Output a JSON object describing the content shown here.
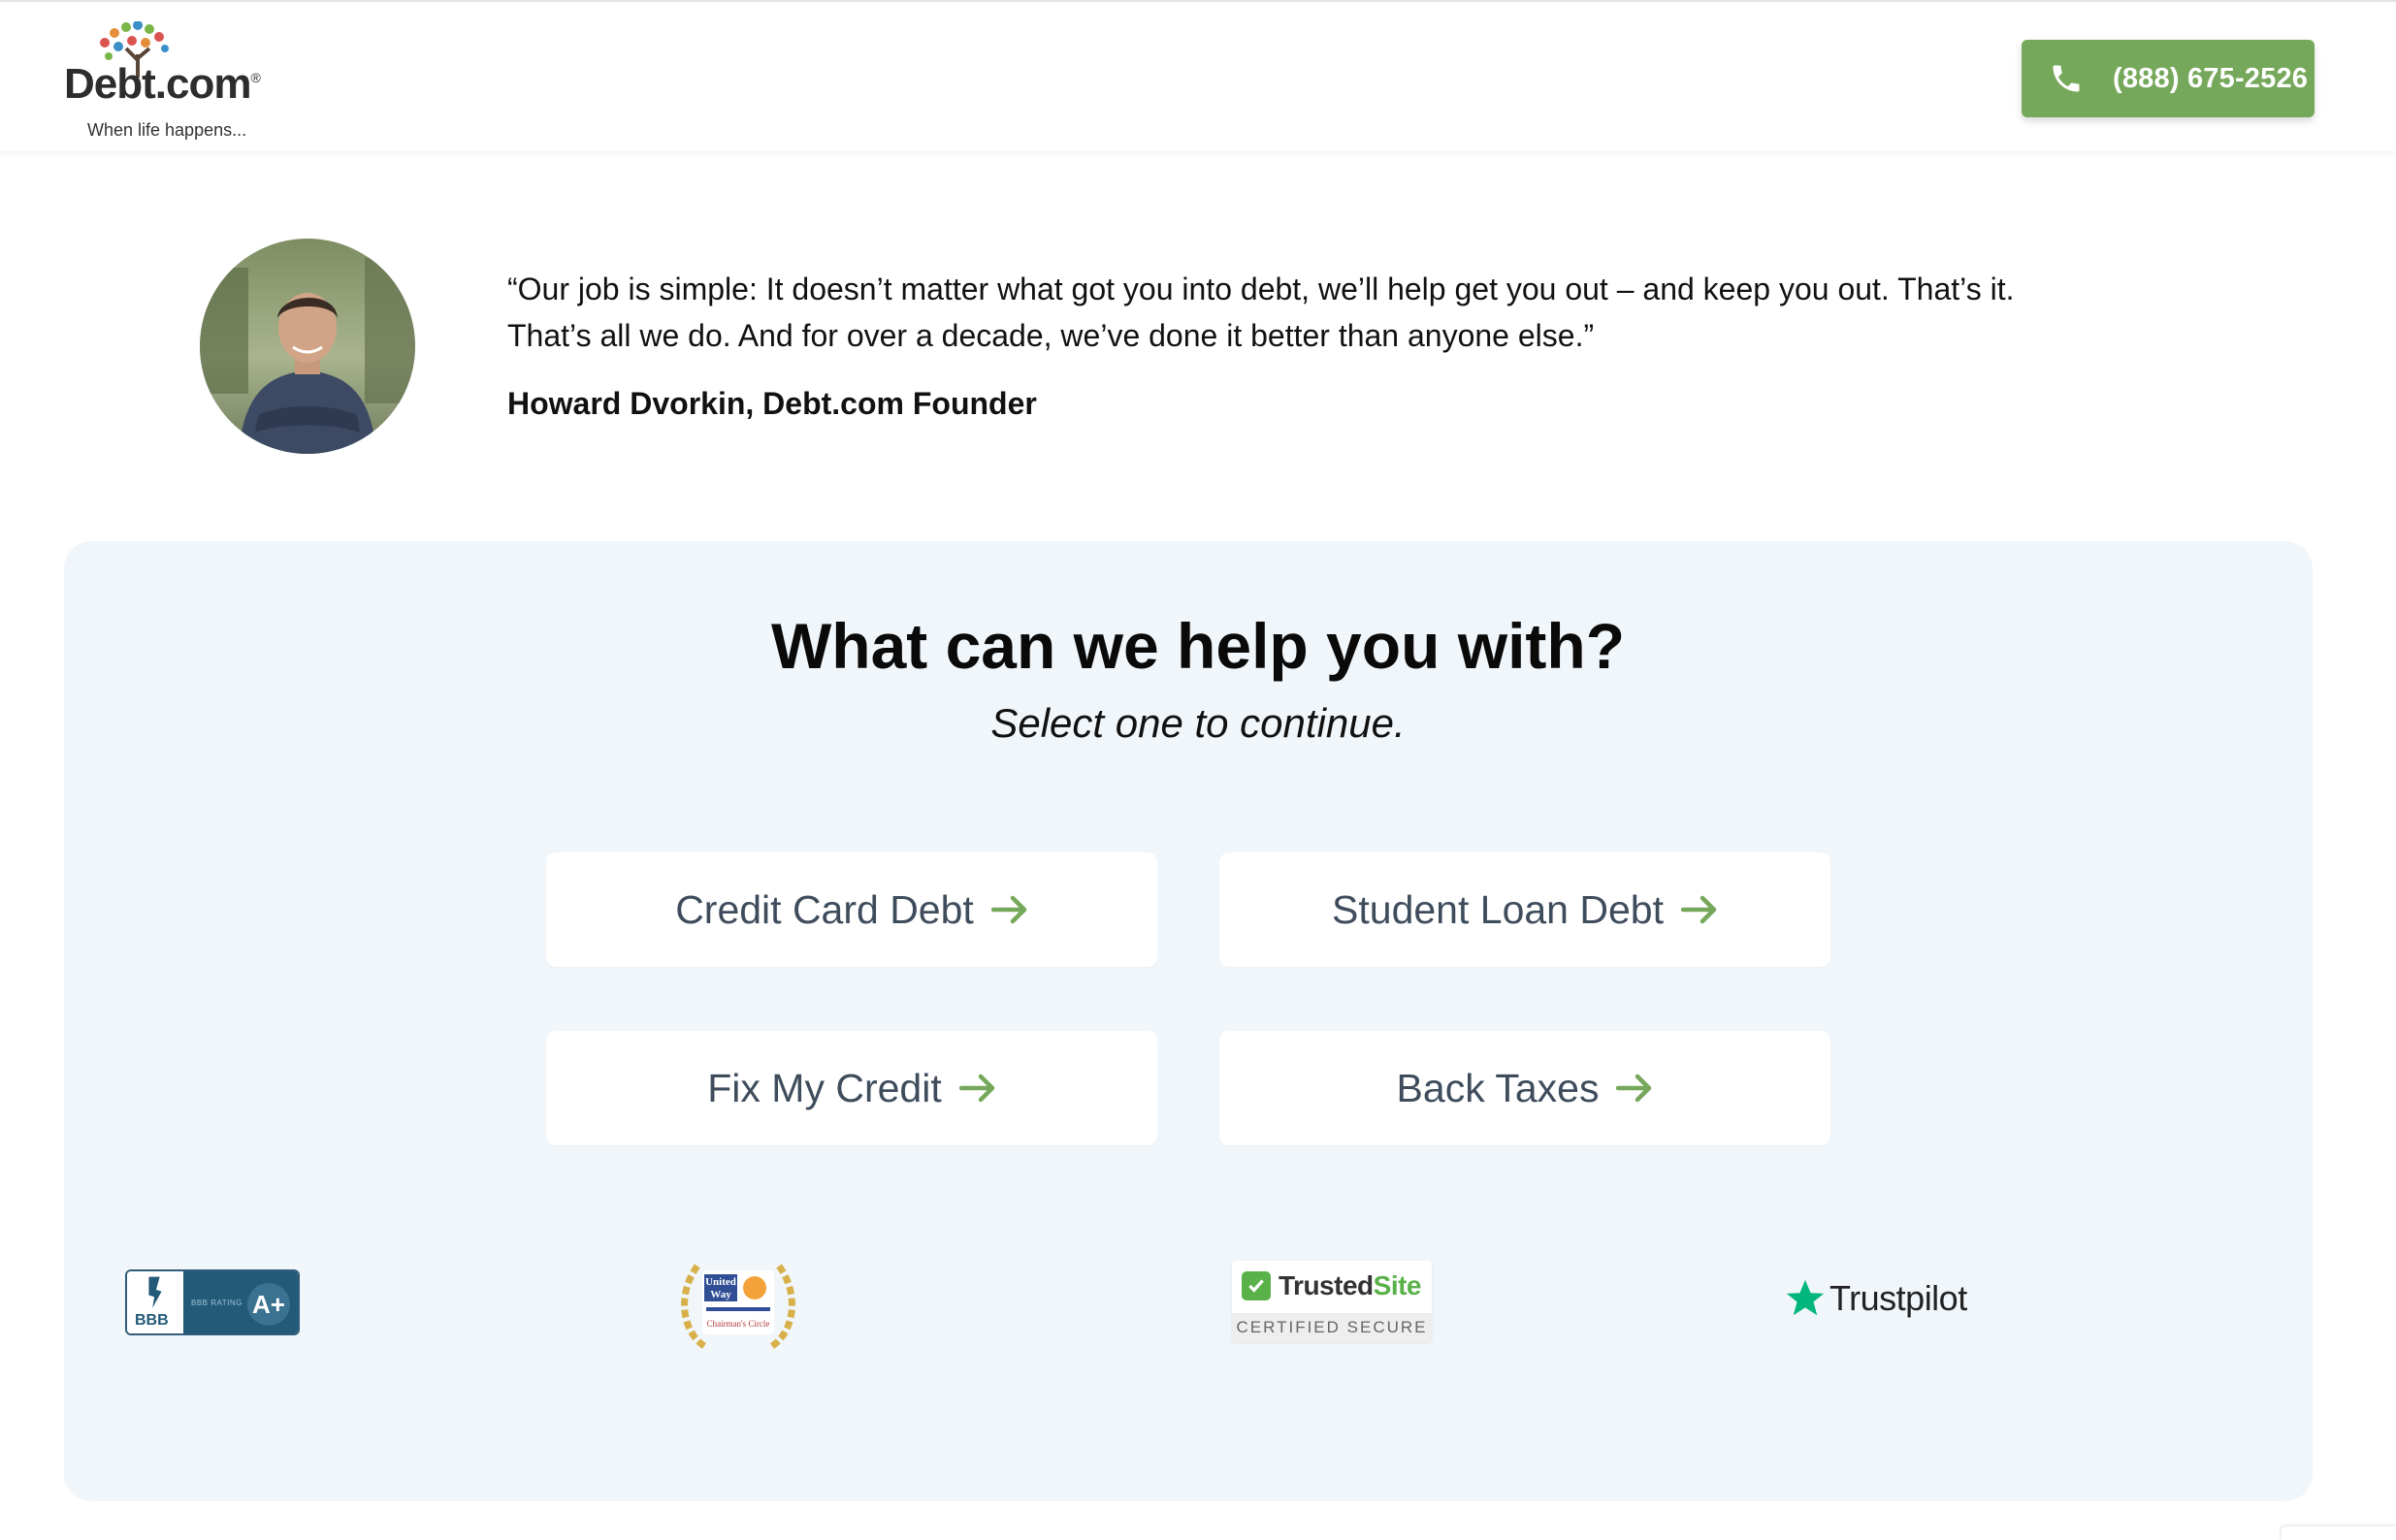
{
  "header": {
    "logo_word": "Debt.com",
    "logo_reg": "®",
    "logo_tagline": "When life happens...",
    "phone": "(888) 675-2526"
  },
  "quote": {
    "text": "“Our job is simple: It doesn’t matter what got you into debt, we’ll help get you out – and keep you out. That’s it. That’s all we do. And for over a decade, we’ve done it better than anyone else.”",
    "author": "Howard Dvorkin, Debt.com Founder"
  },
  "help": {
    "title": "What can we help you with?",
    "subtitle": "Select one to continue.",
    "options": [
      {
        "label": "Credit Card Debt"
      },
      {
        "label": "Student Loan Debt"
      },
      {
        "label": "Fix My Credit"
      },
      {
        "label": "Back Taxes"
      }
    ]
  },
  "badges": {
    "bbb_text": "BBB",
    "bbb_label": "BBB RATING",
    "bbb_grade": "A+",
    "united_way_top": "United",
    "united_way_bottom": "Way",
    "united_way_caption": "Chairman's Circle",
    "trusted_name_a": "Trusted",
    "trusted_name_b": "Site",
    "trusted_sub": "CERTIFIED SECURE",
    "trustpilot": "Trustpilot"
  },
  "colors": {
    "accent_green": "#76a85b",
    "panel_bg": "#f1f6fa",
    "option_text": "#3e4c5c"
  }
}
